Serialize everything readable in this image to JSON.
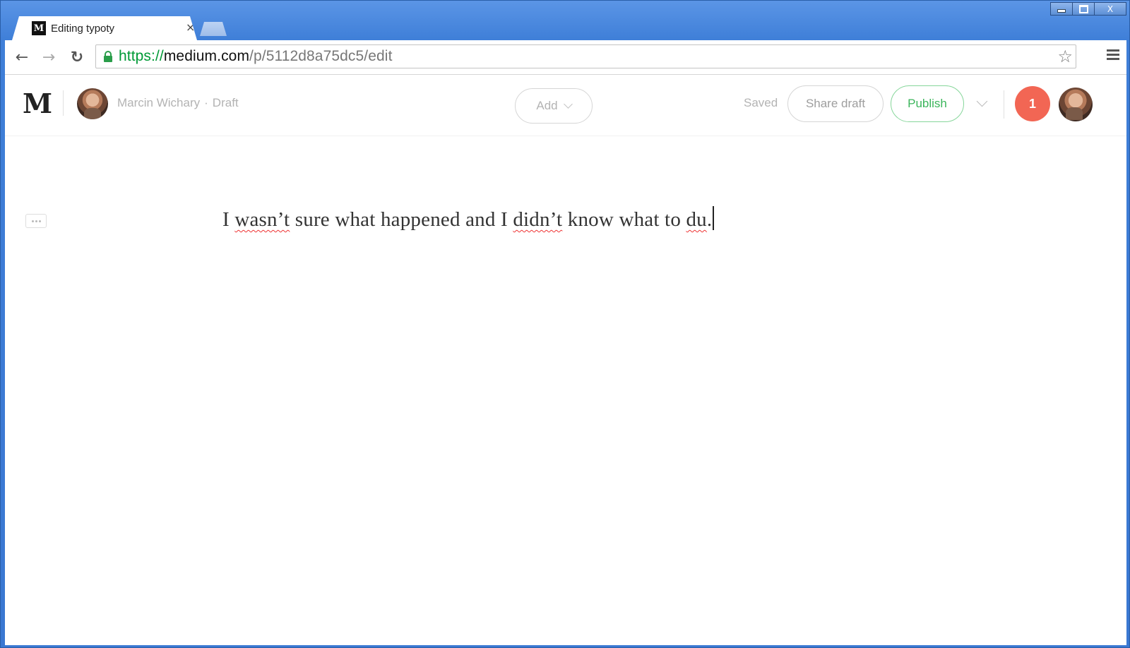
{
  "browser": {
    "tab": {
      "favicon_letter": "M",
      "title": "Editing typoty",
      "close_glyph": "×"
    },
    "window_controls": {
      "close_glyph": "X"
    },
    "omnibox": {
      "url_protocol": "https://",
      "url_host": "medium.com",
      "url_path": "/p/5112d8a75dc5/edit"
    },
    "nav": {
      "back_glyph": "←",
      "forward_glyph": "→",
      "reload_glyph": "↻",
      "star_glyph": "☆"
    }
  },
  "metabar": {
    "logo": "M",
    "author_name": "Marcin Wichary",
    "separator": "·",
    "status": "Draft",
    "add_label": "Add",
    "saved_label": "Saved",
    "share_label": "Share draft",
    "publish_label": "Publish",
    "notification_count": "1"
  },
  "editor": {
    "parts": [
      "I ",
      "wasn’t",
      " sure what happened and I ",
      "didn’t",
      " know what to ",
      "du",
      "."
    ]
  },
  "colors": {
    "publish_green": "#3bb55b",
    "notification_red": "#f26654",
    "url_green": "#009a36"
  }
}
